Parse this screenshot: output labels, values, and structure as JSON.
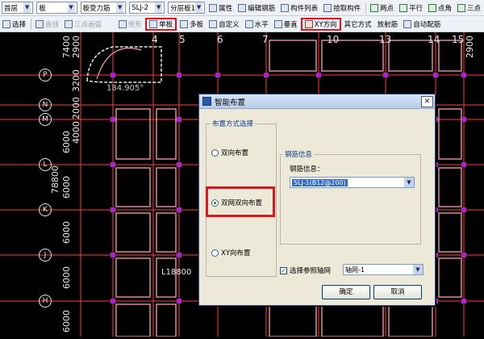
{
  "toolbar1": {
    "floor": "首层",
    "component_type": "板",
    "rebar_type": "板受力筋",
    "rebar_name": "SLJ-2",
    "layer": "分层板1",
    "property": "属性",
    "edit_rebar": "编辑钢筋",
    "component_list": "构件列表",
    "pick_component": "拾取构件",
    "two_points": "两点",
    "parallel": "平行",
    "point_angle": "点角",
    "three": "三点"
  },
  "toolbar2": {
    "select": "选择",
    "line": "直线",
    "three_point_arc": "三点画弧",
    "rect": "矩形",
    "single_board": "单板",
    "multi_board": "多板",
    "custom": "自定义",
    "horizontal": "水平",
    "vertical": "垂直",
    "xy_direction": "XY方向",
    "other_method": "其它方式",
    "radial": "放射筋",
    "auto_layout": "自动配筋"
  },
  "canvas": {
    "col_axes": [
      "4",
      "5",
      "6",
      "7",
      "10",
      "13",
      "14",
      "15"
    ],
    "row_axes": [
      "P",
      "N",
      "M",
      "L",
      "K",
      "J",
      "H"
    ],
    "dims_left": [
      "7400",
      "2900",
      "3200",
      "2000",
      "4000",
      "6000",
      "6000",
      "6000",
      "6000",
      "6000",
      "78800"
    ],
    "dim_top_right": "2900",
    "annotation": "184.905°",
    "dim_label": "L18800"
  },
  "dialog": {
    "title": "智能布置",
    "group_method": "布置方式选择",
    "opt_both": "双向布置",
    "opt_dual_net": "双网双向布置",
    "opt_xy": "XY向布置",
    "group_info": "钢筋信息",
    "info_label": "钢筋信息：",
    "info_value": "SLJ-1(B12@200)",
    "ref_axis_label": "选择参照轴网",
    "ref_axis_value": "轴网-1",
    "ok": "确定",
    "cancel": "取消"
  },
  "colors": {
    "grid_line": "#ff3c3c",
    "slab_rect": "#ff9bb3",
    "node": "#b020d0",
    "highlight": "#e0141a"
  }
}
